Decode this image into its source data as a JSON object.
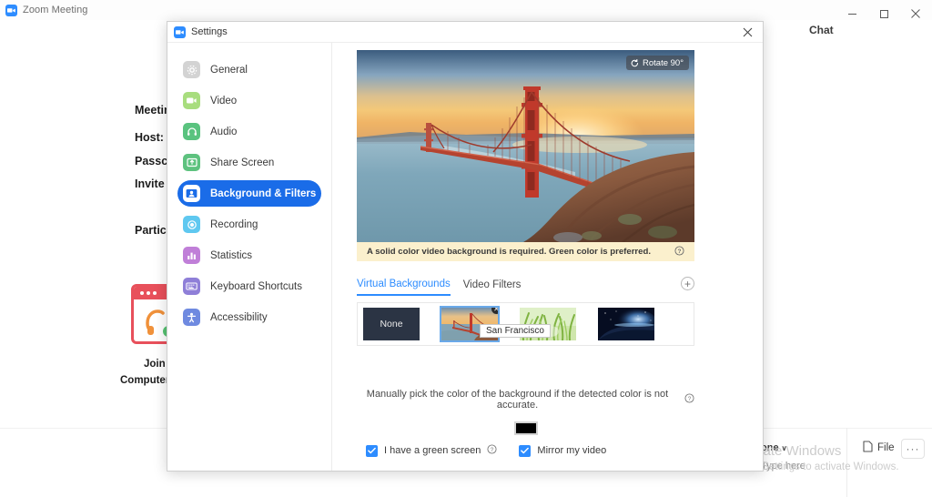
{
  "window": {
    "title": "Zoom Meeting",
    "minimize_label": "─",
    "maximize_label": "❐",
    "close_label": "✕",
    "chat_panel_label": "Chat"
  },
  "meeting_info": {
    "labels": [
      "Meeting",
      "Host:",
      "Passcode",
      "Invite",
      "Participant"
    ],
    "join_audio_line1": "Join",
    "join_audio_line2": "Computer Au"
  },
  "chat_toolbar": {
    "send_to_label": "one",
    "send_to_caret": "∨",
    "type_here_placeholder": "Type here",
    "file_label": "File",
    "more_label": "···"
  },
  "watermark": {
    "line1": "Activate Windows",
    "line2": "Go to Settings to activate Windows."
  },
  "dialog": {
    "title": "Settings",
    "close_label": "✕",
    "sidebar": [
      {
        "label": "General",
        "icon": "gear-icon",
        "active": false,
        "color": "#d3d3d3"
      },
      {
        "label": "Video",
        "icon": "video-camera-icon",
        "active": false,
        "color": "#a8dd7e"
      },
      {
        "label": "Audio",
        "icon": "headset-icon",
        "active": false,
        "color": "#5ac37f"
      },
      {
        "label": "Share Screen",
        "icon": "share-screen-icon",
        "active": false,
        "color": "#5ec27f"
      },
      {
        "label": "Background & Filters",
        "icon": "person-card-icon",
        "active": true,
        "color": "#1a6ce8"
      },
      {
        "label": "Recording",
        "icon": "record-circle-icon",
        "active": false,
        "color": "#5fc8f0"
      },
      {
        "label": "Statistics",
        "icon": "bar-chart-icon",
        "active": false,
        "color": "#c07fd8"
      },
      {
        "label": "Keyboard Shortcuts",
        "icon": "keyboard-icon",
        "active": false,
        "color": "#8f7fd8"
      },
      {
        "label": "Accessibility",
        "icon": "accessibility-icon",
        "active": false,
        "color": "#6f8ae0"
      }
    ],
    "preview": {
      "rotate_label": "Rotate 90°",
      "image_description": "golden-gate-bridge-sunset"
    },
    "notice": {
      "text": "A solid color video background is required. Green color is preferred.",
      "help_label": "?"
    },
    "tabs": [
      {
        "label": "Virtual Backgrounds",
        "active": true
      },
      {
        "label": "Video Filters",
        "active": false
      }
    ],
    "add_button_label": "+",
    "thumbnails": [
      {
        "label": "None",
        "kind": "none",
        "selected": false
      },
      {
        "label": "San Francisco",
        "kind": "bridge",
        "selected": true,
        "remove_label": "✕",
        "tooltip": "San Francisco"
      },
      {
        "label": "Grass",
        "kind": "grass",
        "selected": false
      },
      {
        "label": "Earth",
        "kind": "earth",
        "selected": false
      }
    ],
    "manual_color": {
      "text": "Manually pick the color of the background if the detected color is not accurate.",
      "help_label": "?",
      "swatch_color": "#000000"
    },
    "options": [
      {
        "label": "I have a green screen",
        "checked": true,
        "has_help": true,
        "help_label": "?"
      },
      {
        "label": "Mirror my video",
        "checked": true,
        "has_help": false
      }
    ]
  },
  "colors": {
    "accent": "#2d8cff",
    "active_nav": "#1a6ce8",
    "notice_bg": "#fbf0cd"
  }
}
